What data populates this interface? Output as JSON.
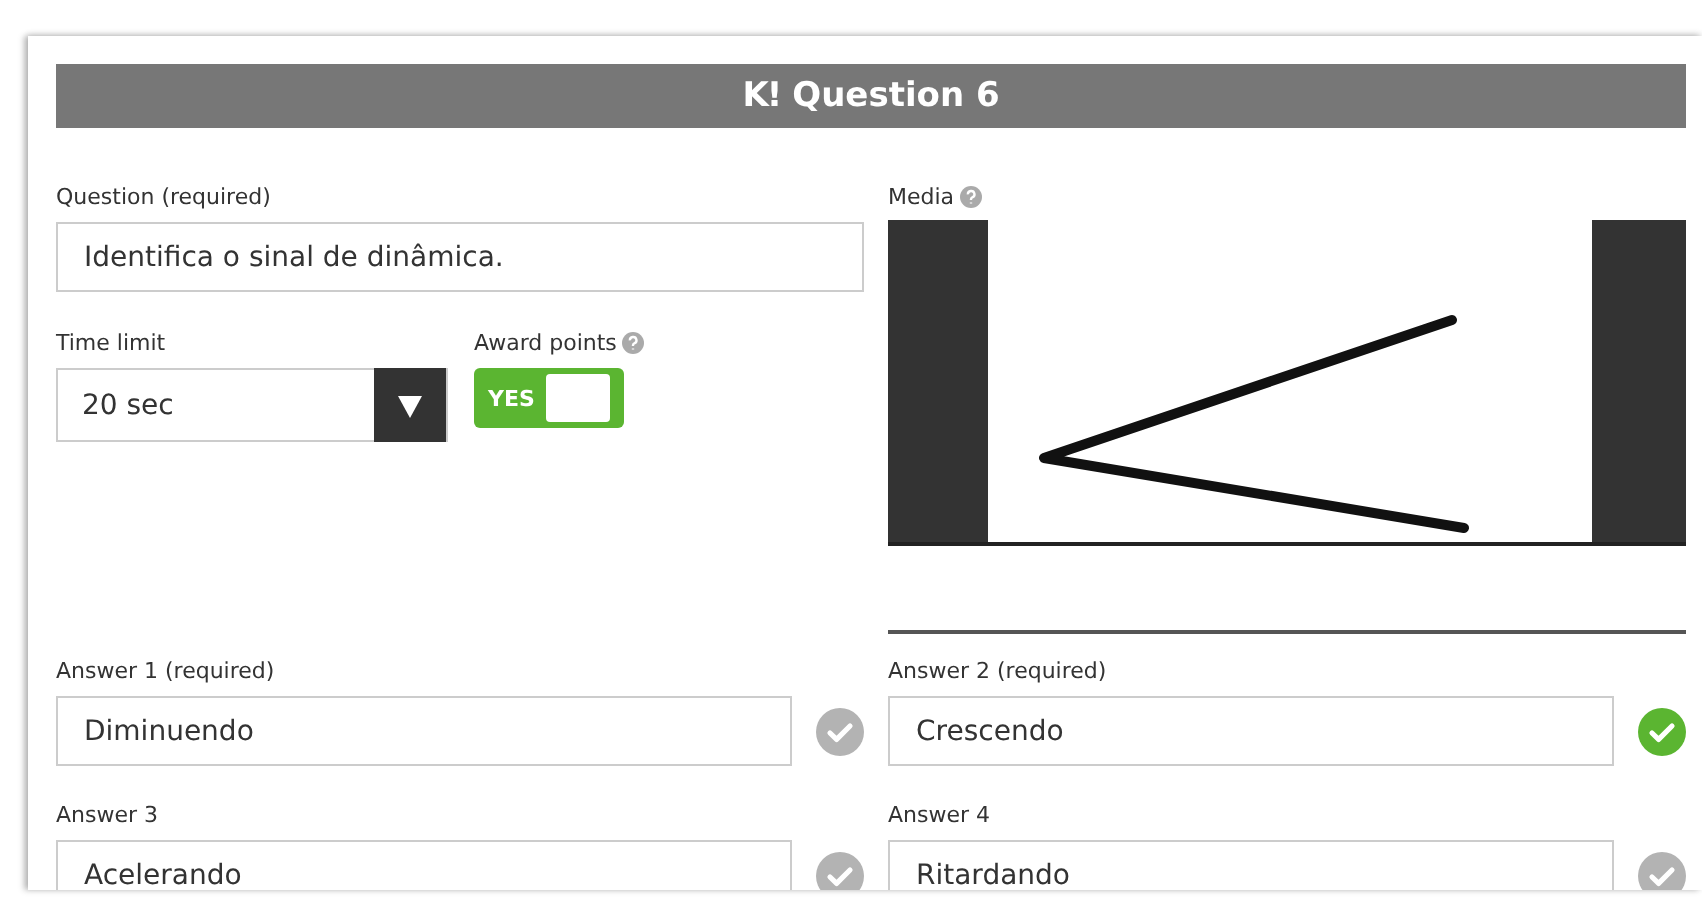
{
  "header": {
    "logo": "K!",
    "title": "Question 6"
  },
  "question": {
    "label": "Question (required)",
    "value": "Identifica o sinal de dinâmica."
  },
  "time_limit": {
    "label": "Time limit",
    "value": "20 sec"
  },
  "award_points": {
    "label": "Award points",
    "on": true,
    "toggle_text": "YES"
  },
  "media": {
    "label": "Media"
  },
  "answers": [
    {
      "label": "Answer 1 (required)",
      "value": "Diminuendo",
      "correct": false
    },
    {
      "label": "Answer 2 (required)",
      "value": "Crescendo",
      "correct": true
    },
    {
      "label": "Answer 3",
      "value": "Acelerando",
      "correct": false
    },
    {
      "label": "Answer 4",
      "value": "Ritardando",
      "correct": false
    }
  ]
}
